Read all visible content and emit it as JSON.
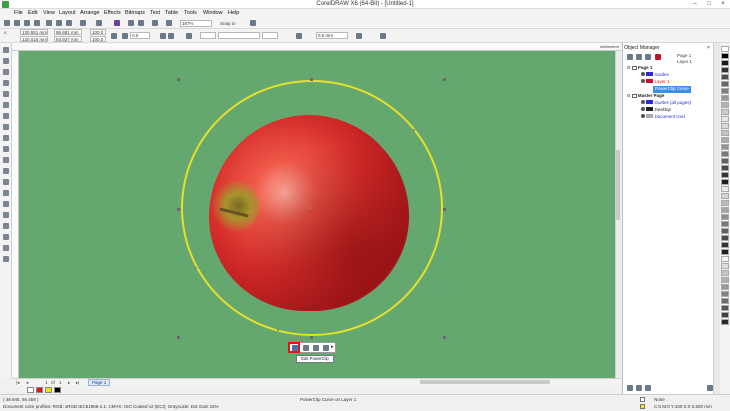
{
  "window": {
    "title": "CorelDRAW X6 (64-Bit) - [Untitled-1]"
  },
  "menu": [
    "File",
    "Edit",
    "View",
    "Layout",
    "Arrange",
    "Effects",
    "Bitmaps",
    "Text",
    "Table",
    "Tools",
    "Window",
    "Help"
  ],
  "standard_toolbar": {
    "zoom": "187%",
    "snap_to": "Snap to"
  },
  "property_bar": {
    "x": "130.551 mm",
    "y": "120.015 mm",
    "width": "96.681 mm",
    "height": "93.937 mm",
    "scale_x": "100.0",
    "scale_y": "100.0",
    "rotation": "0.0",
    "outline_width": "0.5 mm"
  },
  "ruler": {
    "units": "millimeters"
  },
  "powerclip_toolbar": {
    "tooltip": "Edit PowerClip"
  },
  "page_nav": {
    "position": "1",
    "of_label": "of",
    "total": "1",
    "page_tab": "Page 1"
  },
  "status_bar": {
    "cursor": "( 48.945, 66.459 )",
    "selection": "PowerClip Curve on Layer 1",
    "color_profile": "Document color profiles: RGB: sRGB IEC61966-2.1; CMYK: ISO Coated v2 (ECI); Grayscale: Dot Gain 15%",
    "fill": "None",
    "outline": "C:0 M:0 Y:100 K:0  0.500 mm"
  },
  "object_manager": {
    "title": "Object Manager",
    "top": {
      "page": "Page 1",
      "layer": "Layer 1"
    },
    "tree": [
      {
        "label": "Page 1",
        "level": 0,
        "bold": true
      },
      {
        "label": "Guides",
        "level": 1,
        "color": "#2a2ad6"
      },
      {
        "label": "Layer 1",
        "level": 1,
        "color": "#c8102e"
      },
      {
        "label": "PowerClip Curve",
        "level": 2,
        "selected": true
      },
      {
        "label": "Master Page",
        "level": 0,
        "bold": true
      },
      {
        "label": "Guides (all pages)",
        "level": 1,
        "color": "#2a2ad6"
      },
      {
        "label": "Desktop",
        "level": 1,
        "color": "#222"
      },
      {
        "label": "Document Grid",
        "level": 1,
        "color": "#777"
      }
    ]
  },
  "colors": {
    "canvas": "#65a86f",
    "ellipse_outline": "#e6df2b",
    "highlight": "#e0141b"
  }
}
